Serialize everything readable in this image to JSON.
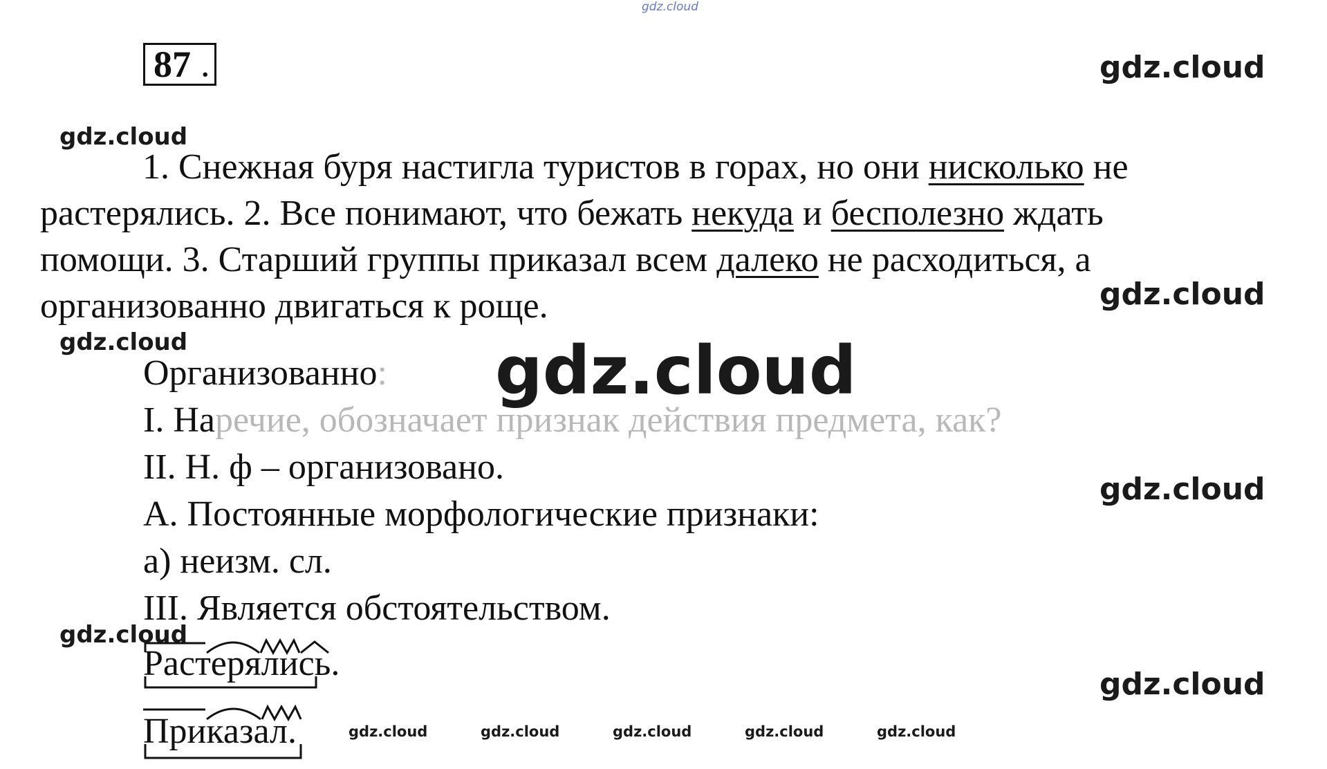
{
  "watermark": "gdz.cloud",
  "task_number": "87",
  "task_suffix": ".",
  "sentences": {
    "line1_pre": "1. Снежная буря настигла туристов в горах, но они ",
    "line1_u": "нисколько",
    "line1_post": " не",
    "line2_pre": "растерялись. 2. Все понимают, что бежать ",
    "line2_u1": "некуда",
    "line2_mid": " и ",
    "line2_u2": "бесполезно",
    "line2_post": " ждать",
    "line3_pre": "помощи. 3. Старший группы приказал всем ",
    "line3_u": "далеко",
    "line3_post": " не расходиться, а",
    "line4": "организованно двигаться к роще."
  },
  "analysis": {
    "word_a": "Организованно",
    "word_b": ":",
    "i_a": "I. На",
    "i_b": "речие, обозначает признак действия предмета, как?",
    "ii": "II. Н. ф – организовано.",
    "a": "А. Постоянные морфологические признаки:",
    "a1": "а) неизм. сл.",
    "iii": "III. Является обстоятельством."
  },
  "diagrams": {
    "word1": "Растерялись.",
    "word2": "Приказал."
  }
}
